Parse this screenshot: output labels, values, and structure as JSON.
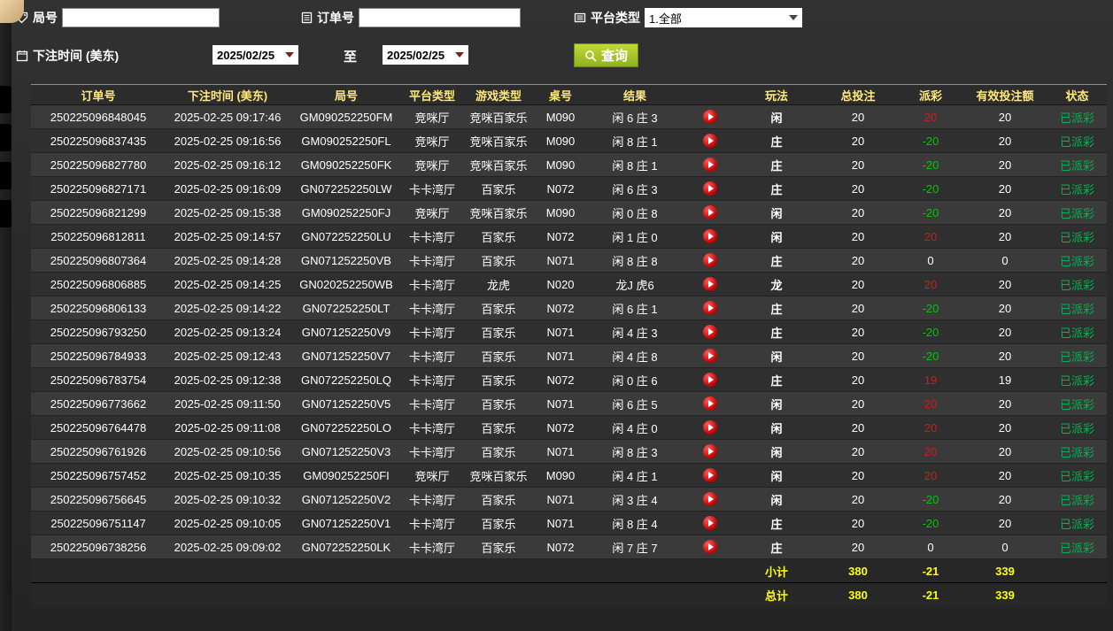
{
  "filters": {
    "round_label": "局号",
    "round_input_value": "",
    "order_label": "订单号",
    "order_input_value": "",
    "platform_label": "平台类型",
    "platform_value": "1.全部",
    "bet_time_label": "下注时间 (美东)",
    "date_from": "2025/02/25",
    "to_label": "至",
    "date_to": "2025/02/25",
    "query_label": "查询"
  },
  "table": {
    "headers": [
      "订单号",
      "下注时间 (美东)",
      "局号",
      "平台类型",
      "游戏类型",
      "桌号",
      "结果",
      "",
      "玩法",
      "总投注",
      "派彩",
      "有效投注额",
      "状态"
    ],
    "rows": [
      {
        "order": "250225096848045",
        "time": "2025-02-25 09:17:46",
        "round": "GM090252250FM",
        "platform": "竞咪厅",
        "game": "竞咪百家乐",
        "table_no": "M090",
        "result": "闲 6 庄 3",
        "play": "闲",
        "total": "20",
        "payout": "20",
        "valid": "20",
        "status": "已派彩"
      },
      {
        "order": "250225096837435",
        "time": "2025-02-25 09:16:56",
        "round": "GM090252250FL",
        "platform": "竞咪厅",
        "game": "竞咪百家乐",
        "table_no": "M090",
        "result": "闲 8 庄 1",
        "play": "庄",
        "total": "20",
        "payout": "-20",
        "valid": "20",
        "status": "已派彩"
      },
      {
        "order": "250225096827780",
        "time": "2025-02-25 09:16:12",
        "round": "GM090252250FK",
        "platform": "竞咪厅",
        "game": "竞咪百家乐",
        "table_no": "M090",
        "result": "闲 8 庄 1",
        "play": "庄",
        "total": "20",
        "payout": "-20",
        "valid": "20",
        "status": "已派彩"
      },
      {
        "order": "250225096827171",
        "time": "2025-02-25 09:16:09",
        "round": "GN072252250LW",
        "platform": "卡卡湾厅",
        "game": "百家乐",
        "table_no": "N072",
        "result": "闲 6 庄 3",
        "play": "庄",
        "total": "20",
        "payout": "-20",
        "valid": "20",
        "status": "已派彩"
      },
      {
        "order": "250225096821299",
        "time": "2025-02-25 09:15:38",
        "round": "GM090252250FJ",
        "platform": "竞咪厅",
        "game": "竞咪百家乐",
        "table_no": "M090",
        "result": "闲 0 庄 8",
        "play": "闲",
        "total": "20",
        "payout": "-20",
        "valid": "20",
        "status": "已派彩"
      },
      {
        "order": "250225096812811",
        "time": "2025-02-25 09:14:57",
        "round": "GN072252250LU",
        "platform": "卡卡湾厅",
        "game": "百家乐",
        "table_no": "N072",
        "result": "闲 1 庄 0",
        "play": "闲",
        "total": "20",
        "payout": "20",
        "valid": "20",
        "status": "已派彩"
      },
      {
        "order": "250225096807364",
        "time": "2025-02-25 09:14:28",
        "round": "GN071252250VB",
        "platform": "卡卡湾厅",
        "game": "百家乐",
        "table_no": "N071",
        "result": "闲 8 庄 8",
        "play": "庄",
        "total": "20",
        "payout": "0",
        "valid": "0",
        "status": "已派彩"
      },
      {
        "order": "250225096806885",
        "time": "2025-02-25 09:14:25",
        "round": "GN020252250WB",
        "platform": "卡卡湾厅",
        "game": "龙虎",
        "table_no": "N020",
        "result": "龙J 虎6",
        "play": "龙",
        "total": "20",
        "payout": "20",
        "valid": "20",
        "status": "已派彩"
      },
      {
        "order": "250225096806133",
        "time": "2025-02-25 09:14:22",
        "round": "GN072252250LT",
        "platform": "卡卡湾厅",
        "game": "百家乐",
        "table_no": "N072",
        "result": "闲 6 庄 1",
        "play": "庄",
        "total": "20",
        "payout": "-20",
        "valid": "20",
        "status": "已派彩"
      },
      {
        "order": "250225096793250",
        "time": "2025-02-25 09:13:24",
        "round": "GN071252250V9",
        "platform": "卡卡湾厅",
        "game": "百家乐",
        "table_no": "N071",
        "result": "闲 4 庄 3",
        "play": "庄",
        "total": "20",
        "payout": "-20",
        "valid": "20",
        "status": "已派彩"
      },
      {
        "order": "250225096784933",
        "time": "2025-02-25 09:12:43",
        "round": "GN071252250V7",
        "platform": "卡卡湾厅",
        "game": "百家乐",
        "table_no": "N071",
        "result": "闲 4 庄 8",
        "play": "闲",
        "total": "20",
        "payout": "-20",
        "valid": "20",
        "status": "已派彩"
      },
      {
        "order": "250225096783754",
        "time": "2025-02-25 09:12:38",
        "round": "GN072252250LQ",
        "platform": "卡卡湾厅",
        "game": "百家乐",
        "table_no": "N072",
        "result": "闲 0 庄 6",
        "play": "庄",
        "total": "20",
        "payout": "19",
        "valid": "19",
        "status": "已派彩"
      },
      {
        "order": "250225096773662",
        "time": "2025-02-25 09:11:50",
        "round": "GN071252250V5",
        "platform": "卡卡湾厅",
        "game": "百家乐",
        "table_no": "N071",
        "result": "闲 6 庄 5",
        "play": "闲",
        "total": "20",
        "payout": "20",
        "valid": "20",
        "status": "已派彩"
      },
      {
        "order": "250225096764478",
        "time": "2025-02-25 09:11:08",
        "round": "GN072252250LO",
        "platform": "卡卡湾厅",
        "game": "百家乐",
        "table_no": "N072",
        "result": "闲 4 庄 0",
        "play": "闲",
        "total": "20",
        "payout": "20",
        "valid": "20",
        "status": "已派彩"
      },
      {
        "order": "250225096761926",
        "time": "2025-02-25 09:10:56",
        "round": "GN071252250V3",
        "platform": "卡卡湾厅",
        "game": "百家乐",
        "table_no": "N071",
        "result": "闲 8 庄 3",
        "play": "闲",
        "total": "20",
        "payout": "20",
        "valid": "20",
        "status": "已派彩"
      },
      {
        "order": "250225096757452",
        "time": "2025-02-25 09:10:35",
        "round": "GM090252250FI",
        "platform": "竞咪厅",
        "game": "竞咪百家乐",
        "table_no": "M090",
        "result": "闲 4 庄 1",
        "play": "闲",
        "total": "20",
        "payout": "20",
        "valid": "20",
        "status": "已派彩"
      },
      {
        "order": "250225096756645",
        "time": "2025-02-25 09:10:32",
        "round": "GN071252250V2",
        "platform": "卡卡湾厅",
        "game": "百家乐",
        "table_no": "N071",
        "result": "闲 3 庄 4",
        "play": "闲",
        "total": "20",
        "payout": "-20",
        "valid": "20",
        "status": "已派彩"
      },
      {
        "order": "250225096751147",
        "time": "2025-02-25 09:10:05",
        "round": "GN071252250V1",
        "platform": "卡卡湾厅",
        "game": "百家乐",
        "table_no": "N071",
        "result": "闲 8 庄 4",
        "play": "庄",
        "total": "20",
        "payout": "-20",
        "valid": "20",
        "status": "已派彩"
      },
      {
        "order": "250225096738256",
        "time": "2025-02-25 09:09:02",
        "round": "GN072252250LK",
        "platform": "卡卡湾厅",
        "game": "百家乐",
        "table_no": "N072",
        "result": "闲 7 庄 7",
        "play": "庄",
        "total": "20",
        "payout": "0",
        "valid": "0",
        "status": "已派彩"
      }
    ],
    "totals": [
      {
        "label": "小计",
        "total": "380",
        "payout": "-21",
        "valid": "339"
      },
      {
        "label": "总计",
        "total": "380",
        "payout": "-21",
        "valid": "339"
      }
    ]
  },
  "colors": {
    "payout_positive": "#c81e1e",
    "payout_negative": "#00c800",
    "status_paid": "#00b450",
    "header_text": "#ffe97a",
    "totals_text": "#ffff00",
    "query_button_green": "#9ebf2a",
    "corner_tab_tan": "#d7b586"
  }
}
